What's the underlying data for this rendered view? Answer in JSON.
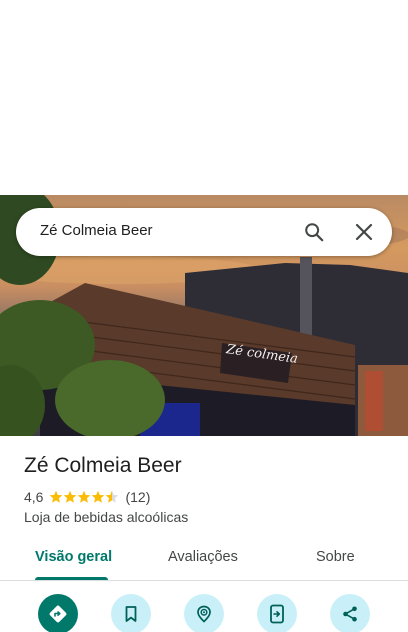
{
  "search": {
    "query": "Zé Colmeia Beer",
    "search_icon": "search-icon",
    "close_icon": "close-icon"
  },
  "hero": {
    "sign_text": "Zé colmeia"
  },
  "place": {
    "name": "Zé Colmeia Beer",
    "rating": "4,6",
    "stars": 4.5,
    "review_count": "(12)",
    "category": "Loja de bebidas alcoólicas"
  },
  "tabs": [
    {
      "label": "Visão geral",
      "active": true
    },
    {
      "label": "Avaliações",
      "active": false
    },
    {
      "label": "Sobre",
      "active": false
    }
  ],
  "actions": [
    {
      "icon": "directions-icon"
    },
    {
      "icon": "bookmark-icon"
    },
    {
      "icon": "nearby-icon"
    },
    {
      "icon": "send-to-phone-icon"
    },
    {
      "icon": "share-icon"
    }
  ],
  "colors": {
    "accent": "#00796b",
    "action_bg": "#c9f0f8",
    "star": "#fbbc04"
  }
}
